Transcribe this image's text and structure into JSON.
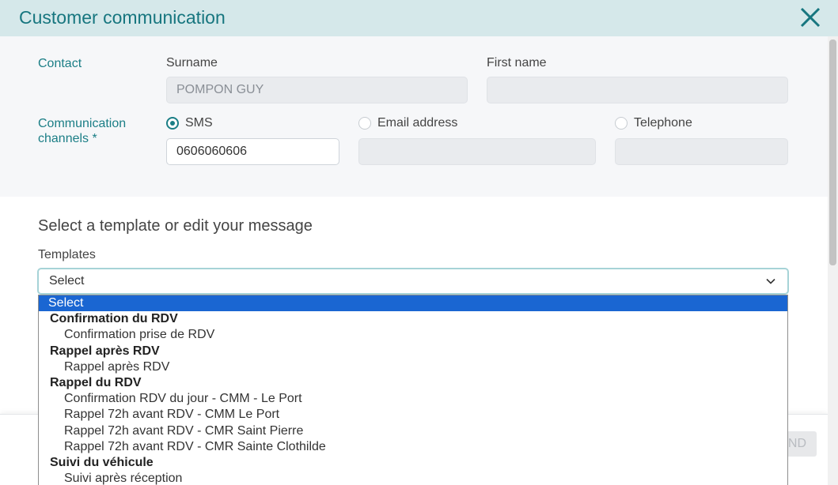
{
  "header": {
    "title": "Customer communication"
  },
  "contact": {
    "section_label": "Contact",
    "surname_label": "Surname",
    "surname_value": "POMPON GUY",
    "firstname_label": "First name",
    "firstname_value": ""
  },
  "channels": {
    "label_line1": "Communication",
    "label_line2": "channels *",
    "sms_label": "SMS",
    "sms_value": "0606060606",
    "email_label": "Email address",
    "email_value": "",
    "phone_label": "Telephone",
    "phone_value": ""
  },
  "message": {
    "section_title": "Select a template or edit your message",
    "templates_label": "Templates",
    "select_value": "Select"
  },
  "dropdown": {
    "selected": "Select",
    "groups": [
      {
        "label": "Confirmation du RDV",
        "options": [
          "Confirmation prise de RDV"
        ]
      },
      {
        "label": "Rappel après RDV",
        "options": [
          "Rappel après RDV"
        ]
      },
      {
        "label": "Rappel du RDV",
        "options": [
          "Confirmation RDV du jour - CMM - Le Port",
          "Rappel 72h avant RDV - CMM Le Port",
          "Rappel 72h avant RDV - CMR Saint Pierre",
          "Rappel 72h avant RDV - CMR Sainte Clothilde"
        ]
      },
      {
        "label": "Suivi du véhicule",
        "options": [
          "Suivi après réception"
        ]
      }
    ]
  },
  "footer": {
    "send_label": "ND"
  },
  "colors": {
    "accent": "#1b7e86",
    "header_bg": "#d5e8ea",
    "selected_option": "#1a66d2"
  }
}
